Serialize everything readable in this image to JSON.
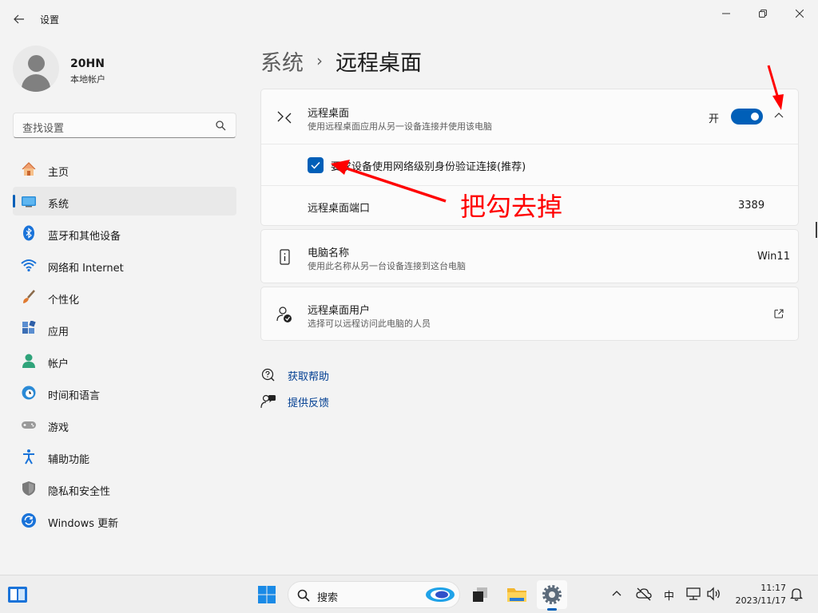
{
  "window": {
    "title": "设置"
  },
  "profile": {
    "name": "20HN",
    "account_type": "本地帐户"
  },
  "search": {
    "placeholder": "查找设置"
  },
  "sidebar": {
    "items": [
      {
        "label": "主页",
        "icon": "home-icon",
        "active": false
      },
      {
        "label": "系统",
        "icon": "system-icon",
        "active": true
      },
      {
        "label": "蓝牙和其他设备",
        "icon": "bluetooth-icon",
        "active": false
      },
      {
        "label": "网络和 Internet",
        "icon": "wifi-icon",
        "active": false
      },
      {
        "label": "个性化",
        "icon": "brush-icon",
        "active": false
      },
      {
        "label": "应用",
        "icon": "apps-icon",
        "active": false
      },
      {
        "label": "帐户",
        "icon": "account-icon",
        "active": false
      },
      {
        "label": "时间和语言",
        "icon": "globe-clock-icon",
        "active": false
      },
      {
        "label": "游戏",
        "icon": "gamepad-icon",
        "active": false
      },
      {
        "label": "辅助功能",
        "icon": "accessibility-icon",
        "active": false
      },
      {
        "label": "隐私和安全性",
        "icon": "shield-icon",
        "active": false
      },
      {
        "label": "Windows 更新",
        "icon": "update-icon",
        "active": false
      }
    ]
  },
  "breadcrumb": {
    "parent": "系统",
    "separator": "›",
    "current": "远程桌面"
  },
  "remote_desktop": {
    "title": "远程桌面",
    "subtitle": "使用远程桌面应用从另一设备连接并使用该电脑",
    "toggle_label": "开",
    "toggle_on": true,
    "nla_checkbox_label": "要求设备使用网络级别身份验证连接(推荐)",
    "nla_checked": true,
    "port_label": "远程桌面端口",
    "port_value": "3389"
  },
  "pc_name": {
    "title": "电脑名称",
    "subtitle": "使用此名称从另一台设备连接到这台电脑",
    "value": "Win11"
  },
  "remote_users": {
    "title": "远程桌面用户",
    "subtitle": "选择可以远程访问此电脑的人员"
  },
  "links": {
    "help": "获取帮助",
    "feedback": "提供反馈"
  },
  "annotation": {
    "text": "把勾去掉",
    "color": "#ff0000"
  },
  "taskbar": {
    "search_placeholder": "搜索",
    "ime": "中",
    "time": "11:17",
    "date": "2023/11/17"
  },
  "colors": {
    "accent": "#005fb8",
    "link": "#003e92",
    "annotation": "#ff0000"
  }
}
